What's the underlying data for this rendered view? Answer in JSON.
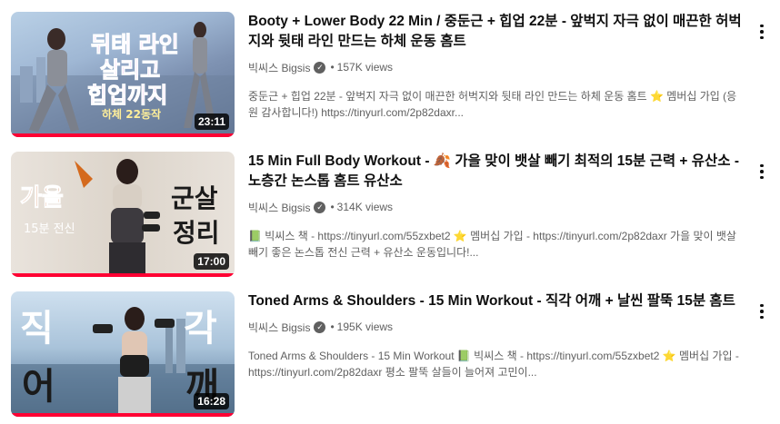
{
  "videos": [
    {
      "title": "Booty + Lower Body 22 Min / 중둔근 + 힙업 22분 - 앞벅지 자극 없이 매끈한 허벅지와 뒷태 라인 만드는 하체 운동 홈트",
      "channel": "빅씨스 Bigsis",
      "views": "157K views",
      "description": "중둔근 + 힙업 22분 - 앞벅지 자극 없이 매끈한 허벅지와 뒷태 라인 만드는 하체 운동 홈트 ⭐ 멤버십 가입 (응원 감사합니다!) https://tinyurl.com/2p82daxr...",
      "duration": "23:11",
      "progress": 1.0,
      "thumb_text": [
        "뒤태 라인",
        "살리고",
        "힙업까지",
        "하체 22동작"
      ]
    },
    {
      "title": "15 Min Full Body Workout - 🍂 가을 맞이 뱃살 빼기 최적의 15분 근력 + 유산소 - 노층간 논스톱 홈트 유산소",
      "channel": "빅씨스 Bigsis",
      "views": "314K views",
      "description": "📗 빅씨스 책 - https://tinyurl.com/55zxbet2 ⭐ 멤버십 가입 - https://tinyurl.com/2p82daxr 가을 맞이 뱃살 빼기 좋은 논스톱 전신 근력 + 유산소 운동입니다!...",
      "duration": "17:00",
      "progress": 1.0,
      "thumb_text": [
        "가을",
        "15분 전신",
        "군살",
        "정리"
      ]
    },
    {
      "title": "Toned Arms & Shoulders - 15 Min Workout - 직각 어깨 + 날씬 팔뚝 15분 홈트",
      "channel": "빅씨스 Bigsis",
      "views": "195K views",
      "description": "Toned Arms & Shoulders - 15 Min Workout 📗 빅씨스 책 - https://tinyurl.com/55zxbet2 ⭐ 멤버십 가입 - https://tinyurl.com/2p82daxr 평소 팔뚝 살들이 늘어져 고민이...",
      "duration": "16:28",
      "progress": 1.0,
      "thumb_text": [
        "직",
        "어",
        "각",
        "깨"
      ]
    }
  ],
  "icons": {
    "verified": "check-circle-icon",
    "more": "more-vert-icon"
  },
  "colors": {
    "progress": "#ff0033",
    "meta": "#606060",
    "title": "#0f0f0f"
  }
}
